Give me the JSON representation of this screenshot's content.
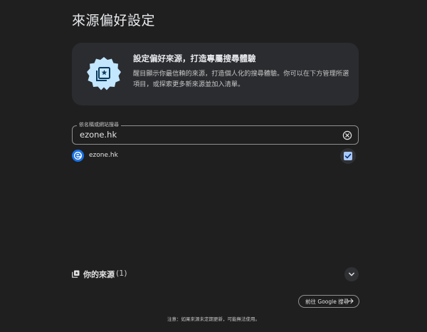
{
  "page": {
    "title": "來源偏好設定"
  },
  "hero": {
    "heading": "設定偏好來源，打造專屬搜尋體驗",
    "description": "醒目顯示你最信賴的來源，打造個人化的搜尋體驗。你可以在下方管理所選項目，或探索更多新來源並加入清單。",
    "badge_icon": "starred-library-icon",
    "badge_color": "#c2e7ff"
  },
  "search": {
    "label": "依名稱或網站搜尋",
    "value": "ezone.hk",
    "clear_icon": "clear-icon"
  },
  "results": [
    {
      "name": "ezone.hk",
      "logo_icon": "ezone-logo-icon",
      "checked": true
    }
  ],
  "sources": {
    "label": "你的來源",
    "count": "(1)",
    "icon": "library-icon",
    "expand_icon": "chevron-down-icon"
  },
  "google_button": {
    "label": "前往 Google 搜尋",
    "icon": "arrow-right-icon"
  },
  "footer": {
    "note": "注意：如果來源未定期更新，可能無法使用。"
  },
  "colors": {
    "background": "#1f1f1f",
    "card": "#2b2c30",
    "accent": "#a8c7fa",
    "badge": "#c2e7ff",
    "logo_blue": "#1a73e8"
  }
}
